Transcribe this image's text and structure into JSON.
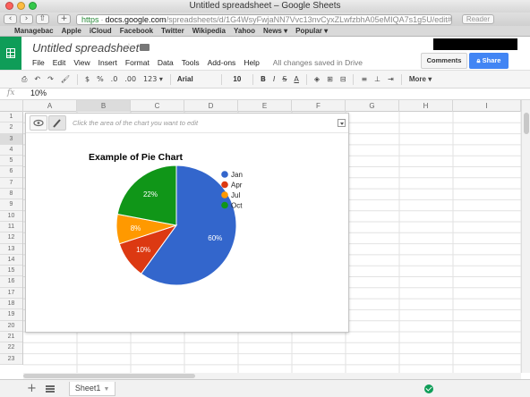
{
  "window": {
    "title": "Untitled spreadsheet – Google Sheets",
    "traffic_lights": [
      "#fc605c",
      "#fdbc40",
      "#34c84a"
    ]
  },
  "browser": {
    "url_scheme": "https",
    "url_host": "docs.google.com",
    "url_path": "/spreadsheets/d/1G4WsyFwjaNN7Vvc13nvCyxZLwfzbhA05eMIQA7s1g5U/edit#gid=0",
    "reader_label": "Reader",
    "bookmarks": [
      "Managebac",
      "Apple",
      "iCloud",
      "Facebook",
      "Twitter",
      "Wikipedia",
      "Yahoo",
      "News ▾",
      "Popular ▾"
    ]
  },
  "doc": {
    "title": "Untitled spreadsheet",
    "menu": [
      "File",
      "Edit",
      "View",
      "Insert",
      "Format",
      "Data",
      "Tools",
      "Add-ons",
      "Help"
    ],
    "saved_status": "All changes saved in Drive",
    "comments_label": "Comments",
    "share_label": "Share"
  },
  "toolbar": {
    "currency": "$",
    "percent": "%",
    "decimal_less": ".0",
    "decimal_more": ".00",
    "number_format": "123 ▾",
    "font": "Arial",
    "font_size": "10",
    "bold": "B",
    "italic": "I",
    "strike": "S",
    "text_color": "A",
    "more": "More"
  },
  "formula": {
    "fx": "fx",
    "value": "10%"
  },
  "grid": {
    "columns": [
      "A",
      "B",
      "C",
      "D",
      "E",
      "F",
      "G",
      "H",
      "I"
    ],
    "rows": [
      "1",
      "2",
      "3",
      "4",
      "5",
      "6",
      "7",
      "8",
      "9",
      "10",
      "11",
      "12",
      "13",
      "14",
      "15",
      "16",
      "17",
      "18",
      "19",
      "20",
      "21",
      "22",
      "23"
    ]
  },
  "chart_editor": {
    "hint": "Click the area of the chart you want to edit"
  },
  "chart_data": {
    "type": "pie",
    "title": "Example of Pie Chart",
    "categories": [
      "Jan",
      "Apr",
      "Jul",
      "Oct"
    ],
    "values": [
      60,
      10,
      8,
      22
    ],
    "labels": [
      "60%",
      "10%",
      "8%",
      "22%"
    ],
    "colors": [
      "#3366cc",
      "#dc3912",
      "#ff9900",
      "#109618"
    ],
    "legend": "right"
  },
  "sheets": {
    "tabs": [
      "Sheet1"
    ],
    "add_label": "+"
  }
}
